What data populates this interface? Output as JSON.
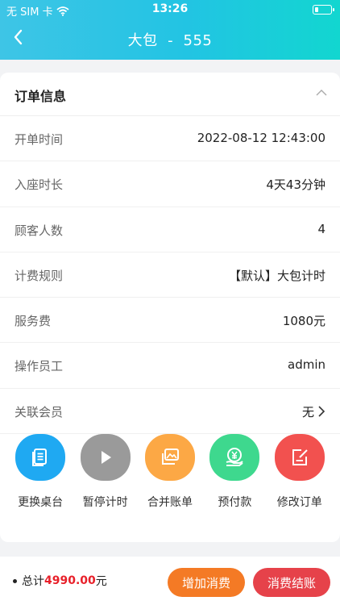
{
  "status_bar": {
    "carrier": "无 SIM 卡",
    "time": "13:26",
    "battery_level": 0.25
  },
  "nav": {
    "title": "大包  -  555"
  },
  "order_info": {
    "title": "订单信息",
    "rows": [
      {
        "label": "开单时间",
        "value": "2022-08-12 12:43:00"
      },
      {
        "label": "入座时长",
        "value": "4天43分钟"
      },
      {
        "label": "顾客人数",
        "value": "4"
      },
      {
        "label": "计费规则",
        "value": "【默认】大包计时"
      },
      {
        "label": "服务费",
        "value": "1080元"
      },
      {
        "label": "操作员工",
        "value": "admin"
      },
      {
        "label": "关联会员",
        "value": "无"
      }
    ]
  },
  "actions": [
    {
      "label": "更换桌台",
      "icon": "document-stack-icon",
      "color": "#1fa9f2"
    },
    {
      "label": "暂停计时",
      "icon": "play-icon",
      "color": "#9a9a9a"
    },
    {
      "label": "合并账单",
      "icon": "merge-images-icon",
      "color": "#fca845"
    },
    {
      "label": "预付款",
      "icon": "yen-hand-icon",
      "color": "#3ed88e"
    },
    {
      "label": "修改订单",
      "icon": "edit-note-icon",
      "color": "#f2514f"
    }
  ],
  "footer": {
    "total_prefix": "总计",
    "total_amount": "4990.00",
    "total_suffix": "元",
    "add_label": "增加消费",
    "add_color": "#f47a25",
    "settle_label": "消费结账",
    "settle_color": "#e6424a"
  }
}
